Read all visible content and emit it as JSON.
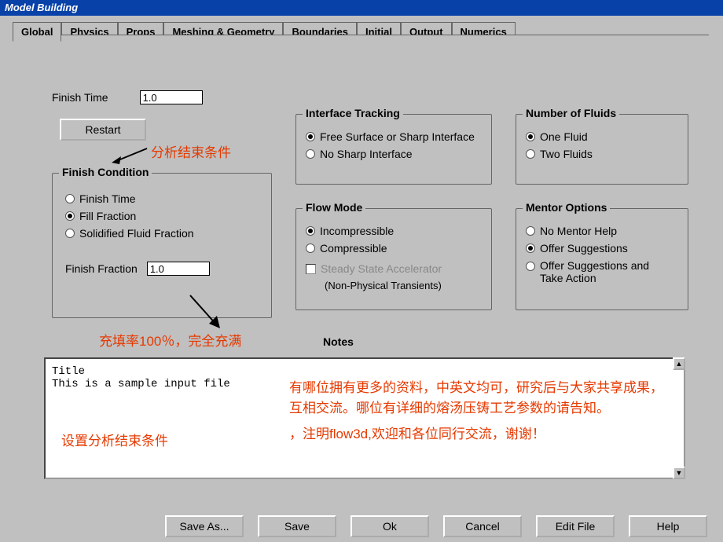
{
  "window": {
    "title": "Model Building"
  },
  "tabs": [
    "Global",
    "Physics",
    "Props",
    "Meshing & Geometry",
    "Boundaries",
    "Initial",
    "Output",
    "Numerics"
  ],
  "active_tab": 0,
  "finish_time": {
    "label": "Finish Time",
    "value": "1.0"
  },
  "restart_btn": "Restart",
  "finish_condition": {
    "legend": "Finish Condition",
    "options": [
      "Finish Time",
      "Fill Fraction",
      "Solidified Fluid Fraction"
    ],
    "selected": 1,
    "fraction_label": "Finish Fraction",
    "fraction_value": "1.0"
  },
  "interface_tracking": {
    "legend": "Interface Tracking",
    "options": [
      "Free Surface or Sharp Interface",
      "No Sharp Interface"
    ],
    "selected": 0
  },
  "flow_mode": {
    "legend": "Flow Mode",
    "options": [
      "Incompressible",
      "Compressible"
    ],
    "selected": 0,
    "checkbox_label": "Steady State Accelerator",
    "checkbox_sub": "(Non-Physical Transients)"
  },
  "number_of_fluids": {
    "legend": "Number of Fluids",
    "options": [
      "One Fluid",
      "Two Fluids"
    ],
    "selected": 0
  },
  "mentor_options": {
    "legend": "Mentor Options",
    "options": [
      "No Mentor Help",
      "Offer Suggestions",
      "Offer Suggestions and Take Action"
    ],
    "selected": 1
  },
  "notes_label": "Notes",
  "notes_text": "Title\nThis is a sample input file",
  "annotations": {
    "a1": "分析结束条件",
    "a2": "充填率100％，完全充满",
    "a3": "设置分析结束条件",
    "a4_line1": "有哪位拥有更多的资料，中英文均可，研究后与大家共享成果，互相交流。哪位有详细的熔汤压铸工艺参数的请告知。",
    "a4_line2": "，注明flow3d,欢迎和各位同行交流，谢谢！"
  },
  "footer": [
    "Save As...",
    "Save",
    "Ok",
    "Cancel",
    "Edit File",
    "Help"
  ]
}
